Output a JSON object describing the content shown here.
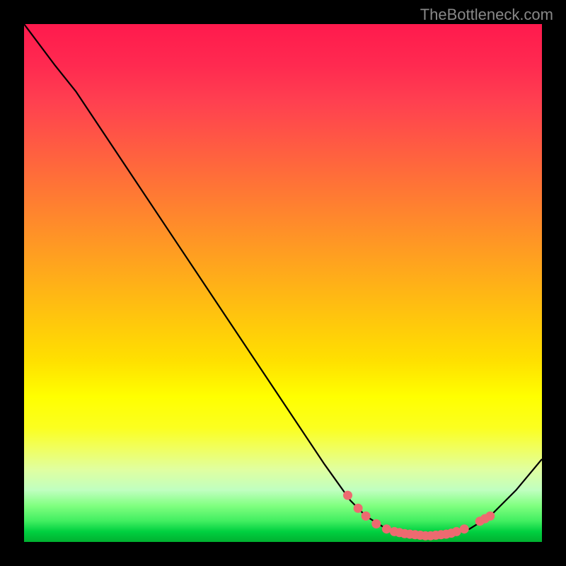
{
  "watermark": "TheBottleneck.com",
  "chart_data": {
    "type": "line",
    "title": "",
    "xlabel": "",
    "ylabel": "",
    "x_range": [
      0,
      100
    ],
    "y_range": [
      0,
      100
    ],
    "curve": [
      {
        "x": 0,
        "y": 100
      },
      {
        "x": 6,
        "y": 92
      },
      {
        "x": 10,
        "y": 87
      },
      {
        "x": 20,
        "y": 72
      },
      {
        "x": 30,
        "y": 57
      },
      {
        "x": 40,
        "y": 42
      },
      {
        "x": 50,
        "y": 27
      },
      {
        "x": 58,
        "y": 15
      },
      {
        "x": 63,
        "y": 8
      },
      {
        "x": 66,
        "y": 5
      },
      {
        "x": 70,
        "y": 2.5
      },
      {
        "x": 74,
        "y": 1.5
      },
      {
        "x": 78,
        "y": 1.2
      },
      {
        "x": 82,
        "y": 1.5
      },
      {
        "x": 86,
        "y": 2.5
      },
      {
        "x": 90,
        "y": 5
      },
      {
        "x": 95,
        "y": 10
      },
      {
        "x": 100,
        "y": 16
      }
    ],
    "highlight_dots": [
      {
        "x": 62.5,
        "y": 9
      },
      {
        "x": 64.5,
        "y": 6.5
      },
      {
        "x": 66,
        "y": 5
      },
      {
        "x": 68,
        "y": 3.5
      },
      {
        "x": 70,
        "y": 2.5
      },
      {
        "x": 71.5,
        "y": 2
      },
      {
        "x": 72.5,
        "y": 1.8
      },
      {
        "x": 73.5,
        "y": 1.6
      },
      {
        "x": 74.5,
        "y": 1.5
      },
      {
        "x": 75.5,
        "y": 1.4
      },
      {
        "x": 76.5,
        "y": 1.3
      },
      {
        "x": 77.5,
        "y": 1.2
      },
      {
        "x": 78.5,
        "y": 1.2
      },
      {
        "x": 79.5,
        "y": 1.3
      },
      {
        "x": 80.5,
        "y": 1.4
      },
      {
        "x": 81.5,
        "y": 1.5
      },
      {
        "x": 82.5,
        "y": 1.7
      },
      {
        "x": 83.5,
        "y": 2
      },
      {
        "x": 85,
        "y": 2.5
      },
      {
        "x": 88,
        "y": 4
      },
      {
        "x": 89,
        "y": 4.5
      },
      {
        "x": 90,
        "y": 5
      }
    ],
    "gradient_bands_meaning": "red=high bottleneck, green=optimal match"
  }
}
